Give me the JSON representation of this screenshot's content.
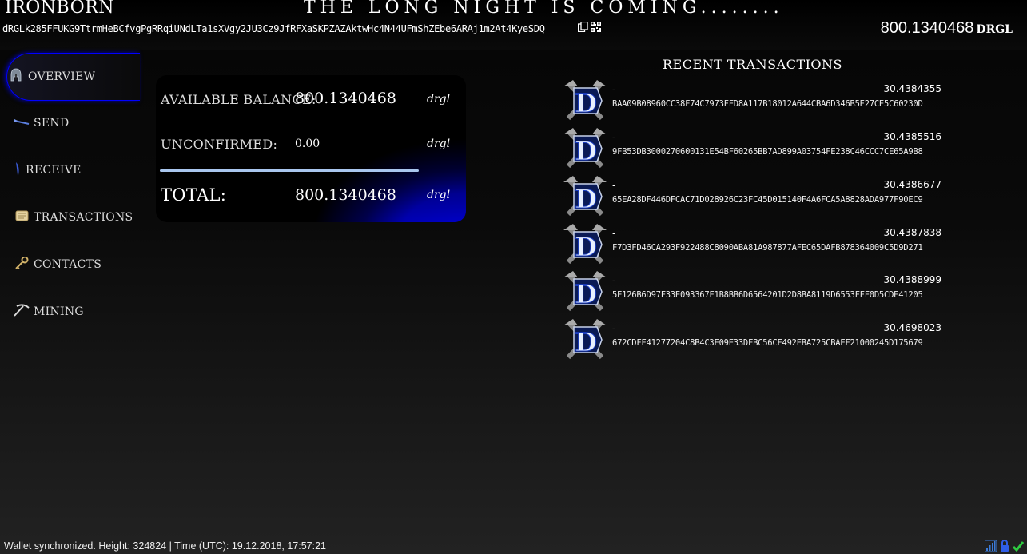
{
  "header": {
    "brand": "IRONBORN",
    "slogan": "THE LONG NIGHT IS COMING........",
    "address": "dRGLk285FFUKG9TtrmHeBCfvgPgRRqiUNdLTa1sXVgy2JU3Cz9JfRFXaSKPZAZAktwHc4N44UFmShZEbe6ARAj1m2At4KyeSDQ",
    "copy_icon": "copy-icon",
    "qr_icon": "qr-code-icon",
    "balance_value": "800.1340468",
    "balance_currency": "DRGL"
  },
  "sidebar": {
    "items": [
      {
        "label": "OVERVIEW",
        "icon": "helmet-icon",
        "active": true
      },
      {
        "label": "SEND",
        "icon": "arrow-icon",
        "active": false
      },
      {
        "label": "RECEIVE",
        "icon": "feather-icon",
        "active": false
      },
      {
        "label": "TRANSACTIONS",
        "icon": "scroll-icon",
        "active": false
      },
      {
        "label": "CONTACTS",
        "icon": "key-icon",
        "active": false
      },
      {
        "label": "MINING",
        "icon": "pickaxe-icon",
        "active": false
      }
    ]
  },
  "balance_card": {
    "available_label": "AVAILABLE BALANCE:",
    "available_value": "800.1340468",
    "unconfirmed_label": "UNCONFIRMED:",
    "unconfirmed_value": "0.00",
    "total_label": "TOTAL:",
    "total_value": "800.1340468",
    "currency": "drgl"
  },
  "recent": {
    "title": "RECENT TRANSACTIONS",
    "transactions": [
      {
        "label": "-",
        "amount": "30.4384355",
        "hash": "BAA09B08960CC38F74C7973FFD8A117B18012A644CBA6D346B5E27CE5C60230D"
      },
      {
        "label": "-",
        "amount": "30.4385516",
        "hash": "9FB53DB3000270600131E54BF60265BB7AD899A03754FE238C46CCC7CE65A9B8"
      },
      {
        "label": "-",
        "amount": "30.4386677",
        "hash": "65EA28DF446DFCAC71D028926C23FC45D015140F4A6FCA5A8828ADA977F90EC9"
      },
      {
        "label": "-",
        "amount": "30.4387838",
        "hash": "F7D3FD46CA293F922488C8090ABA81A987877AFEC65DAFB878364009C5D9D271"
      },
      {
        "label": "-",
        "amount": "30.4388999",
        "hash": "5E126B6D97F33E093367F1B8BB6D6564201D2D8BA8119D6553FFF0D5CDE41205"
      },
      {
        "label": "-",
        "amount": "30.4698023",
        "hash": "672CDFF41277204C8B4C3E09E33DFBC56CF492EBA725CBAEF21000245D175679"
      }
    ],
    "logo_letter": "D"
  },
  "statusbar": {
    "text": "Wallet synchronized. Height: 324824  |  Time (UTC): 19.12.2018, 17:57:21",
    "icons": [
      "signal-icon",
      "lock-icon",
      "checkmark-icon"
    ]
  }
}
